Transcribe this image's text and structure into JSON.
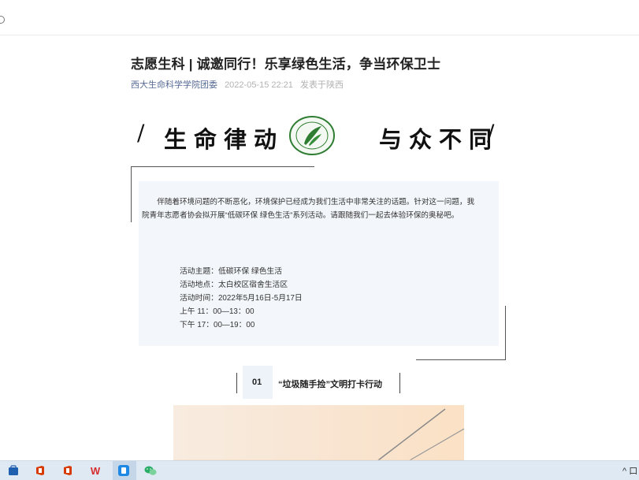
{
  "article": {
    "title": "志愿生科 | 诚邀同行！乐享绿色生活，争当环保卫士",
    "account": "西大生命科学学院团委",
    "datetime": "2022-05-15 22:21",
    "location": "发表于陕西"
  },
  "banner": {
    "slash_left": "/",
    "left_text": "生命律动",
    "right_text": "与众不同",
    "slash_right": "/"
  },
  "intro": "伴随着环境问题的不断恶化，环境保护已经成为我们生活中非常关注的话题。针对这一问题，我院青年志愿者协会拟开展“低碳环保 绿色生活”系列活动。请跟随我们一起去体验环保的奥秘吧。",
  "details": [
    "活动主题：低碳环保 绿色生活",
    "活动地点：太白校区宿舍生活区",
    "活动时间：2022年5月16日-5月17日",
    "上午 11：00—13：00",
    "下午 17：00—19：00"
  ],
  "section": {
    "number": "01",
    "title": "“垃圾随手捡”文明打卡行动"
  },
  "taskbar": {
    "icons": [
      "store-icon",
      "office-icon",
      "office-icon",
      "wps-icon",
      "reader-icon",
      "wechat-icon"
    ],
    "tray": "^ 口"
  },
  "colors": {
    "account_link": "#576b95",
    "meta_gray": "#b2b2b2",
    "infobox_bg": "#f3f6fa",
    "logo_green": "#2e7d32",
    "taskbar_bg": "#dfe9f3"
  }
}
